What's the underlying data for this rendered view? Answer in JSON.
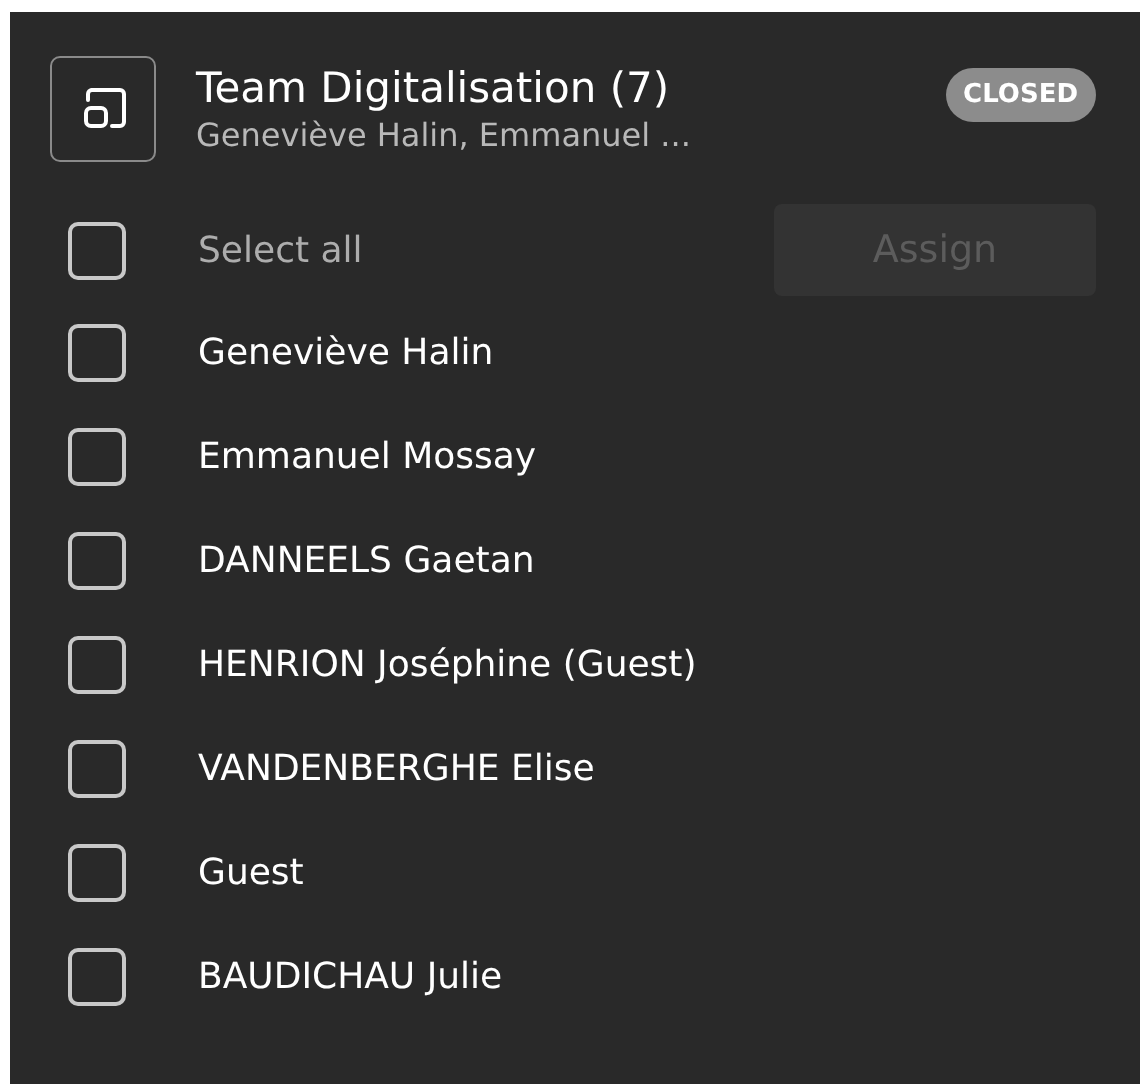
{
  "group": {
    "title": "Team Digitalisation (7)",
    "subtitle": "Geneviève Halin, Emmanuel ...",
    "status": "CLOSED"
  },
  "select_all": {
    "label": "Select all",
    "checked": false
  },
  "assign_button": {
    "label": "Assign",
    "disabled": true
  },
  "members": [
    {
      "name": "Geneviève Halin",
      "checked": false
    },
    {
      "name": "Emmanuel Mossay",
      "checked": false
    },
    {
      "name": "DANNEELS Gaetan",
      "checked": false
    },
    {
      "name": "HENRION Joséphine (Guest)",
      "checked": false
    },
    {
      "name": "VANDENBERGHE Elise",
      "checked": false
    },
    {
      "name": "Guest",
      "checked": false
    },
    {
      "name": "BAUDICHAU Julie",
      "checked": false
    }
  ]
}
